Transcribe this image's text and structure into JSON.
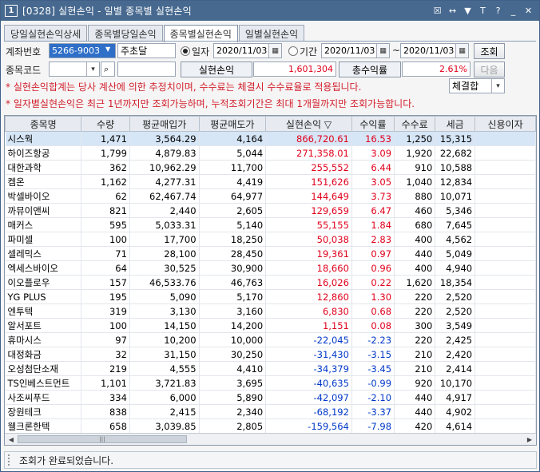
{
  "window": {
    "number": "1",
    "title": "[0328] 실현손익 - 일별 종목별 실현손익",
    "controls": [
      "☒",
      "↔",
      "▼",
      "T",
      "?",
      "_",
      "✕"
    ]
  },
  "tabs": [
    {
      "label": "당일실현손익상세",
      "active": false
    },
    {
      "label": "종목별당일손익",
      "active": false
    },
    {
      "label": "종목별실현손익",
      "active": true
    },
    {
      "label": "일별실현손익",
      "active": false
    }
  ],
  "form": {
    "account_label": "계좌번호",
    "account_value": "5266-9003",
    "account_owner": "주초달",
    "date_radio_label": "일자",
    "date_value": "2020/11/03",
    "period_radio_label": "기간",
    "period_from": "2020/11/03",
    "period_sep": "~",
    "period_to": "2020/11/03",
    "query_button": "조회",
    "stock_code_label": "종목코드",
    "stock_code_value": "",
    "stock_name_value": "",
    "realized_label": "실현손익",
    "realized_value": "1,601,304",
    "total_rate_label": "총수익률",
    "total_rate_value": "2.61%",
    "next_button": "다음",
    "sort_select": "체결합"
  },
  "notices": [
    "* 실현손익합계는 당사 계산에 의한 추정치이며, 수수료는 체결시 수수료율로 적용됩니다.",
    "* 일자별실현손익은 최근 1년까지만 조회가능하며, 누적조회기간은 최대 1개월까지만 조회가능합니다."
  ],
  "table": {
    "columns": [
      "종목명",
      "수량",
      "평균매입가",
      "평균매도가",
      "실현손익 ▽",
      "수익률",
      "수수료",
      "세금",
      "신용이자"
    ],
    "rows": [
      {
        "name": "시스웍",
        "qty": "1,471",
        "buy": "3,564.29",
        "sell": "4,164",
        "pnl": "866,720.61",
        "rate": "16.53",
        "fee": "1,250",
        "tax": "15,315",
        "sign": "pos",
        "selected": true
      },
      {
        "name": "하이즈항공",
        "qty": "1,799",
        "buy": "4,879.83",
        "sell": "5,044",
        "pnl": "271,358.01",
        "rate": "3.09",
        "fee": "1,920",
        "tax": "22,682",
        "sign": "pos"
      },
      {
        "name": "대한과학",
        "qty": "362",
        "buy": "10,962.29",
        "sell": "11,700",
        "pnl": "255,552",
        "rate": "6.44",
        "fee": "910",
        "tax": "10,588",
        "sign": "pos"
      },
      {
        "name": "켐온",
        "qty": "1,162",
        "buy": "4,277.31",
        "sell": "4,419",
        "pnl": "151,626",
        "rate": "3.05",
        "fee": "1,040",
        "tax": "12,834",
        "sign": "pos"
      },
      {
        "name": "박셀바이오",
        "qty": "62",
        "buy": "62,467.74",
        "sell": "64,977",
        "pnl": "144,649",
        "rate": "3.73",
        "fee": "880",
        "tax": "10,071",
        "sign": "pos"
      },
      {
        "name": "까뮤이앤씨",
        "qty": "821",
        "buy": "2,440",
        "sell": "2,605",
        "pnl": "129,659",
        "rate": "6.47",
        "fee": "460",
        "tax": "5,346",
        "sign": "pos"
      },
      {
        "name": "매커스",
        "qty": "595",
        "buy": "5,033.31",
        "sell": "5,140",
        "pnl": "55,155",
        "rate": "1.84",
        "fee": "680",
        "tax": "7,645",
        "sign": "pos"
      },
      {
        "name": "파미셀",
        "qty": "100",
        "buy": "17,700",
        "sell": "18,250",
        "pnl": "50,038",
        "rate": "2.83",
        "fee": "400",
        "tax": "4,562",
        "sign": "pos"
      },
      {
        "name": "셀레믹스",
        "qty": "71",
        "buy": "28,100",
        "sell": "28,450",
        "pnl": "19,361",
        "rate": "0.97",
        "fee": "440",
        "tax": "5,049",
        "sign": "pos"
      },
      {
        "name": "엑세스바이오",
        "qty": "64",
        "buy": "30,525",
        "sell": "30,900",
        "pnl": "18,660",
        "rate": "0.96",
        "fee": "400",
        "tax": "4,940",
        "sign": "pos"
      },
      {
        "name": "이오플로우",
        "qty": "157",
        "buy": "46,533.76",
        "sell": "46,763",
        "pnl": "16,026",
        "rate": "0.22",
        "fee": "1,620",
        "tax": "18,354",
        "sign": "pos"
      },
      {
        "name": "YG PLUS",
        "qty": "195",
        "buy": "5,090",
        "sell": "5,170",
        "pnl": "12,860",
        "rate": "1.30",
        "fee": "220",
        "tax": "2,520",
        "sign": "pos"
      },
      {
        "name": "엔투텍",
        "qty": "319",
        "buy": "3,130",
        "sell": "3,160",
        "pnl": "6,830",
        "rate": "0.68",
        "fee": "220",
        "tax": "2,520",
        "sign": "pos"
      },
      {
        "name": "알서포트",
        "qty": "100",
        "buy": "14,150",
        "sell": "14,200",
        "pnl": "1,151",
        "rate": "0.08",
        "fee": "300",
        "tax": "3,549",
        "sign": "pos"
      },
      {
        "name": "휴마시스",
        "qty": "97",
        "buy": "10,200",
        "sell": "10,000",
        "pnl": "-22,045",
        "rate": "-2.23",
        "fee": "220",
        "tax": "2,425",
        "sign": "neg"
      },
      {
        "name": "대정화금",
        "qty": "32",
        "buy": "31,150",
        "sell": "30,250",
        "pnl": "-31,430",
        "rate": "-3.15",
        "fee": "210",
        "tax": "2,420",
        "sign": "neg"
      },
      {
        "name": "오성첨단소재",
        "qty": "219",
        "buy": "4,555",
        "sell": "4,410",
        "pnl": "-34,379",
        "rate": "-3.45",
        "fee": "210",
        "tax": "2,414",
        "sign": "neg"
      },
      {
        "name": "TS인베스트먼트",
        "qty": "1,101",
        "buy": "3,721.83",
        "sell": "3,695",
        "pnl": "-40,635",
        "rate": "-0.99",
        "fee": "920",
        "tax": "10,170",
        "sign": "neg"
      },
      {
        "name": "사조씨푸드",
        "qty": "334",
        "buy": "6,000",
        "sell": "5,890",
        "pnl": "-42,097",
        "rate": "-2.10",
        "fee": "440",
        "tax": "4,917",
        "sign": "neg"
      },
      {
        "name": "장원테크",
        "qty": "838",
        "buy": "2,415",
        "sell": "2,340",
        "pnl": "-68,192",
        "rate": "-3.37",
        "fee": "440",
        "tax": "4,902",
        "sign": "neg"
      },
      {
        "name": "웰크론한텍",
        "qty": "658",
        "buy": "3,039.85",
        "sell": "2,805",
        "pnl": "-159,564",
        "rate": "-7.98",
        "fee": "420",
        "tax": "4,614",
        "sign": "neg"
      }
    ]
  },
  "status": {
    "message": "조회가 완료되었습니다."
  }
}
